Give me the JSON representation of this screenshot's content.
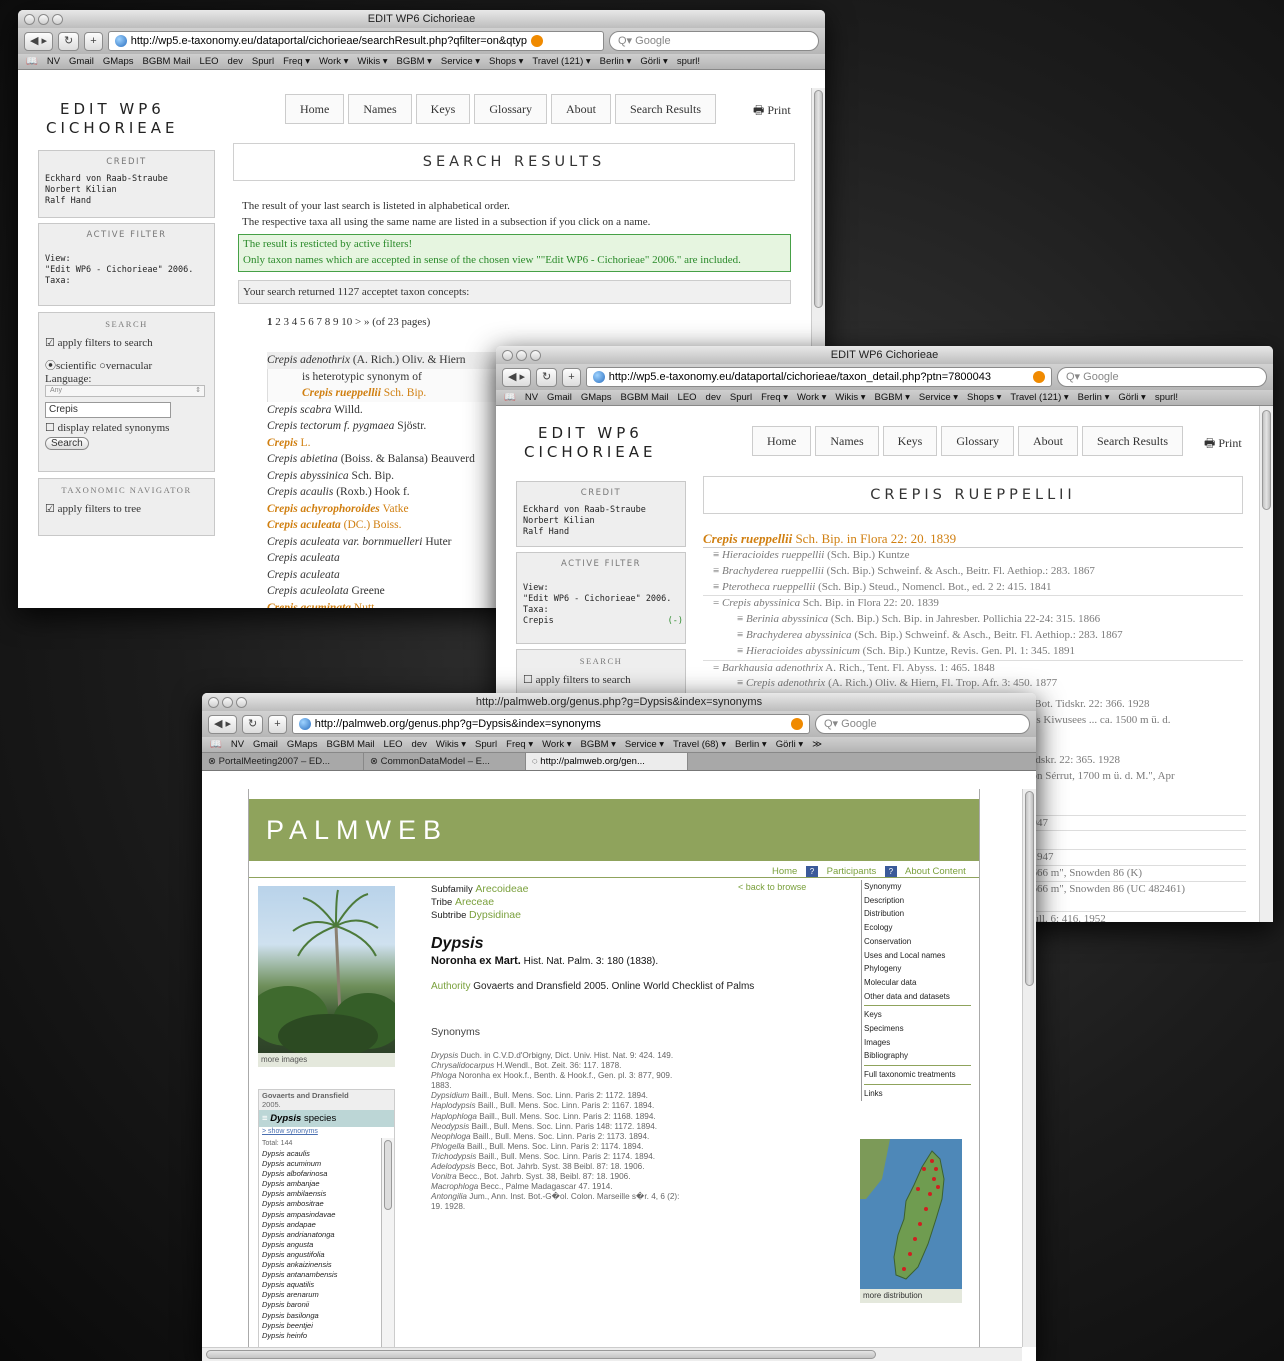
{
  "win1": {
    "title": "EDIT WP6 Cichorieae",
    "url": "http://wp5.e-taxonomy.eu/dataportal/cichorieae/searchResult.php?qfilter=on&qtyp",
    "search_placeholder": "Google",
    "bookmarks": [
      "NV",
      "Gmail",
      "GMaps",
      "BGBM Mail",
      "LEO",
      "dev",
      "Spurl",
      "Freq ▾",
      "Work ▾",
      "Wikis ▾",
      "BGBM ▾",
      "Service ▾",
      "Shops ▾",
      "Travel (121) ▾",
      "Berlin ▾",
      "Görli ▾",
      "spurl!"
    ],
    "site_title_1": "EDIT WP6",
    "site_title_2": "CICHORIEAE",
    "nav": [
      "Home",
      "Names",
      "Keys",
      "Glossary",
      "About",
      "Search Results"
    ],
    "print": "Print",
    "credit_head": "CREDIT",
    "credit": "Eckhard von Raab-Straube\nNorbert Kilian\nRalf Hand",
    "active_filter_head": "ACTIVE FILTER",
    "active_filter": "View:\n\"Edit WP6 - Cichorieae\" 2006.\nTaxa:",
    "search_head": "SEARCH",
    "apply_filters": "apply filters to search",
    "scientific": "scientific",
    "vernacular": "vernacular",
    "language_label": "Language:",
    "language_value": "Any",
    "search_value": "Crepis",
    "display_synonyms": "display related synonyms",
    "search_button": "Search",
    "tax_nav_head": "TAXONOMIC NAVIGATOR",
    "apply_tree": "apply filters to tree",
    "heading": "SEARCH RESULTS",
    "intro1": "The result of your last search is listeted in alphabetical order.",
    "intro2": "The respective taxa all using the same name are listed in a subsection if you click on a name.",
    "notice1": "The result is resticted by active filters!",
    "notice2": "Only taxon names which are accepted in sense of the chosen view \"\"Edit WP6 - Cichorieae\" 2006.\" are included.",
    "count": "Your search returned 1127 acceptet taxon concepts:",
    "pager_current": "1",
    "pager": "2 3 4 5 6 7 8 9 10 > » (of 23 pages)",
    "results": [
      {
        "name": "Crepis adenothrix",
        "author": " (A. Rich.) Oliv. & Hiern",
        "hl": false
      },
      {
        "name": "",
        "author": "is heterotypic synonym of",
        "hl": false,
        "indent": true
      },
      {
        "name": "Crepis rueppellii",
        "author": " Sch. Bip.",
        "hl": true,
        "indent": true
      },
      {
        "name": "Crepis scabra",
        "author": " Willd.",
        "hl": false
      },
      {
        "name": "Crepis tectorum f. pygmaea",
        "author": " Sjöstr.",
        "hl": false
      },
      {
        "name": "Crepis",
        "author": " L.",
        "hl": true
      },
      {
        "name": "Crepis abietina",
        "author": " (Boiss. & Balansa) Beauverd",
        "hl": false
      },
      {
        "name": "Crepis abyssinica",
        "author": " Sch. Bip.",
        "hl": false
      },
      {
        "name": "Crepis acaulis",
        "author": " (Roxb.) Hook f.",
        "hl": false
      },
      {
        "name": "Crepis achyrophoroides",
        "author": " Vatke",
        "hl": true
      },
      {
        "name": "Crepis aculeata",
        "author": " (DC.) Boiss.",
        "hl": true
      },
      {
        "name": "Crepis aculeata var. bornmuelleri",
        "author": " Huter",
        "hl": false
      },
      {
        "name": "Crepis aculeata",
        "author": "",
        "hl": false
      },
      {
        "name": "Crepis aculeata",
        "author": "",
        "hl": false
      },
      {
        "name": "Crepis aculeolata",
        "author": " Greene",
        "hl": false
      },
      {
        "name": "Crepis acuminata",
        "author": " Nutt.",
        "hl": true
      },
      {
        "name": "Crepis acuminata subsp. pluriflora",
        "author": " Babc. & Sta",
        "hl": false
      }
    ]
  },
  "win2": {
    "title": "EDIT WP6 Cichorieae",
    "url": "http://wp5.e-taxonomy.eu/dataportal/cichorieae/taxon_detail.php?ptn=7800043",
    "search_placeholder": "Google",
    "bookmarks": [
      "NV",
      "Gmail",
      "GMaps",
      "BGBM Mail",
      "LEO",
      "dev",
      "Spurl",
      "Freq ▾",
      "Work ▾",
      "Wikis ▾",
      "BGBM ▾",
      "Service ▾",
      "Shops ▾",
      "Travel (121) ▾",
      "Berlin ▾",
      "Görli ▾",
      "spurl!"
    ],
    "site_title_1": "EDIT WP6",
    "site_title_2": "CICHORIEAE",
    "nav": [
      "Home",
      "Names",
      "Keys",
      "Glossary",
      "About",
      "Search Results"
    ],
    "print": "Print",
    "credit_head": "CREDIT",
    "credit": "Eckhard von Raab-Straube\nNorbert Kilian\nRalf Hand",
    "active_filter_head": "ACTIVE FILTER",
    "active_filter": "View:\n\"Edit WP6 - Cichorieae\" 2006.\nTaxa:\nCrepis",
    "filter_remove": "(-)",
    "search_head": "SEARCH",
    "apply_filters": "apply filters to search",
    "heading": "CREPIS RUEPPELLII",
    "accepted_name": "Crepis rueppellii",
    "accepted_ref": " Sch. Bip. in Flora 22: 20. 1839",
    "synonyms": [
      {
        "pre": "≡ ",
        "name": "Hieracioides rueppellii",
        "ref": " (Sch. Bip.) Kuntze",
        "lvl": 1
      },
      {
        "pre": "≡ ",
        "name": "Brachyderea rueppellii",
        "ref": " (Sch. Bip.) Schweinf. & Asch., Beitr. Fl. Aethiop.: 283. 1867",
        "lvl": 1
      },
      {
        "pre": "≡ ",
        "name": "Pterotheca rueppellii",
        "ref": " (Sch. Bip.) Steud., Nomencl. Bot., ed. 2 2: 415. 1841",
        "lvl": 1
      },
      {
        "pre": "= ",
        "name": "Crepis abyssinica",
        "ref": " Sch. Bip. in Flora 22: 20. 1839",
        "lvl": 1
      },
      {
        "pre": "≡ ",
        "name": "Berinia abyssinica",
        "ref": " (Sch. Bip.) Sch. Bip. in Jahresber. Pollichia 22-24: 315. 1866",
        "lvl": 2
      },
      {
        "pre": "≡ ",
        "name": "Brachyderea abyssinica",
        "ref": " (Sch. Bip.) Schweinf. & Asch., Beitr. Fl. Aethiop.: 283. 1867",
        "lvl": 2
      },
      {
        "pre": "≡ ",
        "name": "Hieracioides abyssinicum",
        "ref": " (Sch. Bip.) Kuntze, Revis. Gen. Pl. 1: 345. 1891",
        "lvl": 2
      },
      {
        "pre": "= ",
        "name": "Barkhausia adenothrix",
        "ref": " A. Rich., Tent. Fl. Abyss. 1: 465. 1848",
        "lvl": 1
      },
      {
        "pre": "≡ ",
        "name": "Crepis adenothrix",
        "ref": " (A. Rich.) Oliv. & Hiern, Fl. Trop. Afr. 3: 450. 1877",
        "lvl": 2
      }
    ],
    "partial": [
      "k Bot. Tidskr. 22: 366. 1928",
      "des Kiwusees ... ca. 1500 m ü. d.",
      "Tidskr. 22: 365. 1928",
      "gon Sérrut, 1700 m ü. d. M.\", Apr",
      "1947",
      "7",
      ". 1947",
      "1666 m\", Snowden 86 (K)",
      "1666 m\", Snowden 86 (UC 482461)",
      "Bull. 6: 416. 1952"
    ]
  },
  "win3": {
    "title": "http://palmweb.org/genus.php?g=Dypsis&index=synonyms",
    "url": "http://palmweb.org/genus.php?g=Dypsis&index=synonyms",
    "search_placeholder": "Google",
    "bookmarks": [
      "NV",
      "Gmail",
      "GMaps",
      "BGBM Mail",
      "LEO",
      "dev",
      "Wikis ▾",
      "Spurl",
      "Freq ▾",
      "Work ▾",
      "BGBM ▾",
      "Service ▾",
      "Travel (68) ▾",
      "Berlin ▾",
      "Görli ▾",
      "≫"
    ],
    "tabs": [
      "PortalMeeting2007 – ED...",
      "CommonDataModel – E...",
      "http://palmweb.org/gen..."
    ],
    "banner": "PALMWEB",
    "top_links": [
      "Home",
      "Participants",
      "About Content"
    ],
    "back": "< back to browse",
    "subfamily_label": "Subfamily",
    "subfamily": "Arecoideae",
    "tribe_label": "Tribe",
    "tribe": "Areceae",
    "subtribe_label": "Subtribe",
    "subtribe": "Dypsidinae",
    "genus": "Dypsis",
    "genus_author": "Noronha ex Mart.",
    "genus_ref": " Hist. Nat. Palm. 3: 180 (1838).",
    "authority_label": "Authority",
    "authority": " Govaerts and Dransfield 2005. Online World Checklist of Palms",
    "synonyms_head": "Synonyms",
    "synonyms": [
      {
        "n": "Drypsis",
        "r": "  Duch. in C.V.D.d'Orbigny, Dict. Univ. Hist. Nat. 9: 424. 149."
      },
      {
        "n": "Chrysalidocarpus",
        "r": "  H.Wendl., Bot. Zeit. 36: 117. 1878."
      },
      {
        "n": "Phloga",
        "r": "  Noronha ex Hook.f., Benth. & Hook.f., Gen. pl. 3: 877, 909."
      },
      {
        "n": "",
        "r": "1883."
      },
      {
        "n": "Dypsidium",
        "r": "  Baill., Bull. Mens. Soc. Linn. Paris 2: 1172. 1894."
      },
      {
        "n": "Haplodypsis",
        "r": "  Baill., Bull. Mens. Soc. Linn. Paris 2: 1167. 1894."
      },
      {
        "n": "Haplophloga",
        "r": "  Baill., Bull. Mens. Soc. Linn. Paris 2: 1168. 1894."
      },
      {
        "n": "Neodypsis",
        "r": "  Baill., Bull. Mens. Soc. Linn. Paris 148: 1172. 1894."
      },
      {
        "n": "Neophloga",
        "r": "  Baill., Bull. Mens. Soc. Linn. Paris 2: 1173. 1894."
      },
      {
        "n": "Phlogella",
        "r": "  Baill., Bull. Mens. Soc. Linn. Paris 2: 1174. 1894."
      },
      {
        "n": "Trichodypsis",
        "r": "  Baill., Bull. Mens. Soc. Linn. Paris 2: 1174. 1894."
      },
      {
        "n": "Adelodypsis",
        "r": "  Becc, Bot. Jahrb. Syst. 38 Beibl. 87: 18. 1906."
      },
      {
        "n": "Vonitra",
        "r": "  Becc., Bot. Jahrb. Syst. 38, Beibl. 87: 18. 1906."
      },
      {
        "n": "Macrophloga",
        "r": "  Becc., Palme Madagascar 47. 1914."
      },
      {
        "n": "Antongilia",
        "r": "  Jum., Ann. Inst. Bot.-G�ol. Colon. Marseille s�r. 4, 6 (2):"
      },
      {
        "n": "",
        "r": "19. 1928."
      }
    ],
    "more_images": "more images",
    "checklist_source": "Govaerts and Dransfield",
    "checklist_year": "2005.",
    "species_genus": "Dypsis",
    "species_label": " species",
    "show_synonyms": "show synonyms",
    "total": "Total: 144",
    "species": [
      "Dypsis acaulis",
      "Dypsis acuminum",
      "Dypsis albofarinosa",
      "Dypsis ambanjae",
      "Dypsis ambilaensis",
      "Dypsis ambositrae",
      "Dypsis ampasindavae",
      "Dypsis andapae",
      "Dypsis andrianatonga",
      "Dypsis angusta",
      "Dypsis angustifolia",
      "Dypsis ankaizinensis",
      "Dypsis antanambensis",
      "Dypsis aquatilis",
      "Dypsis arenarum",
      "Dypsis baronii",
      "Dypsis basilonga",
      "Dypsis beentjei",
      "Dypsis heinfo"
    ],
    "menu1": [
      "Synonymy",
      "Description",
      "Distribution",
      "Ecology",
      "Conservation",
      "Uses and Local names",
      "Phylogeny",
      "Molecular data",
      "Other data and datasets"
    ],
    "menu2": [
      "Keys",
      "Specimens",
      "Images",
      "Bibliography"
    ],
    "menu3": [
      "Full taxonomic treatments"
    ],
    "menu4": [
      "Links"
    ],
    "more_distribution": "more distribution",
    "accent": "#8fa35c"
  }
}
